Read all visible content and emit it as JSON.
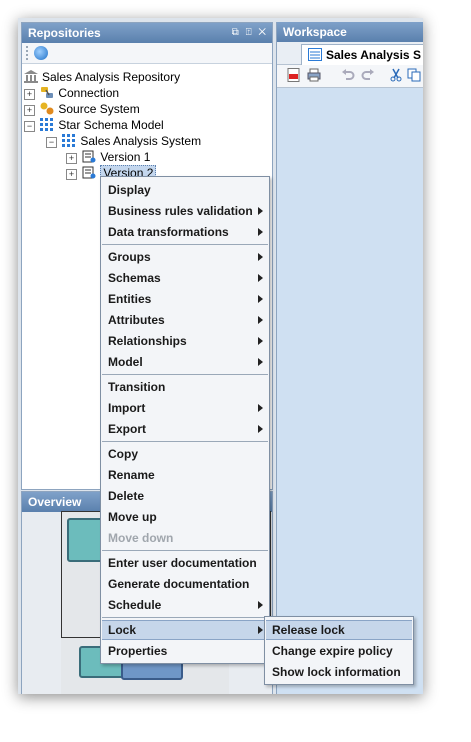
{
  "repositories": {
    "title": "Repositories",
    "controls": "⧉ ⍐ ✕",
    "tree": [
      {
        "label": "Sales Analysis Repository",
        "icon": "repository-icon"
      },
      {
        "label": "Connection",
        "icon": "connection-icon"
      },
      {
        "label": "Source System",
        "icon": "source-system-icon"
      },
      {
        "label": "Star Schema Model",
        "icon": "star-schema-icon"
      },
      {
        "label": "Sales Analysis System",
        "icon": "system-icon"
      },
      {
        "label": "Version 1",
        "icon": "version-icon"
      },
      {
        "label": "Version 2",
        "icon": "version-icon"
      }
    ]
  },
  "overview": {
    "title": "Overview"
  },
  "workspace": {
    "title": "Workspace",
    "tab_label": "Sales Analysis S"
  },
  "context_menu": {
    "items": [
      {
        "label": "Display"
      },
      {
        "label": "Business rules validation"
      },
      {
        "label": "Data transformations"
      },
      {
        "label": "Groups"
      },
      {
        "label": "Schemas"
      },
      {
        "label": "Entities"
      },
      {
        "label": "Attributes"
      },
      {
        "label": "Relationships"
      },
      {
        "label": "Model"
      },
      {
        "label": "Transition"
      },
      {
        "label": "Import"
      },
      {
        "label": "Export"
      },
      {
        "label": "Copy"
      },
      {
        "label": "Rename"
      },
      {
        "label": "Delete"
      },
      {
        "label": "Move up"
      },
      {
        "label": "Move down",
        "disabled": true
      },
      {
        "label": "Enter user documentation"
      },
      {
        "label": "Generate documentation"
      },
      {
        "label": "Schedule"
      },
      {
        "label": "Lock",
        "active": true
      },
      {
        "label": "Properties"
      }
    ]
  },
  "lock_submenu": {
    "items": [
      {
        "label": "Release lock",
        "active": true
      },
      {
        "label": "Change expire policy"
      },
      {
        "label": "Show lock information"
      }
    ]
  },
  "colors": {
    "header": "#6b8fbb",
    "selection": "#c4d7ee",
    "workspace": "#cfe0f2"
  }
}
